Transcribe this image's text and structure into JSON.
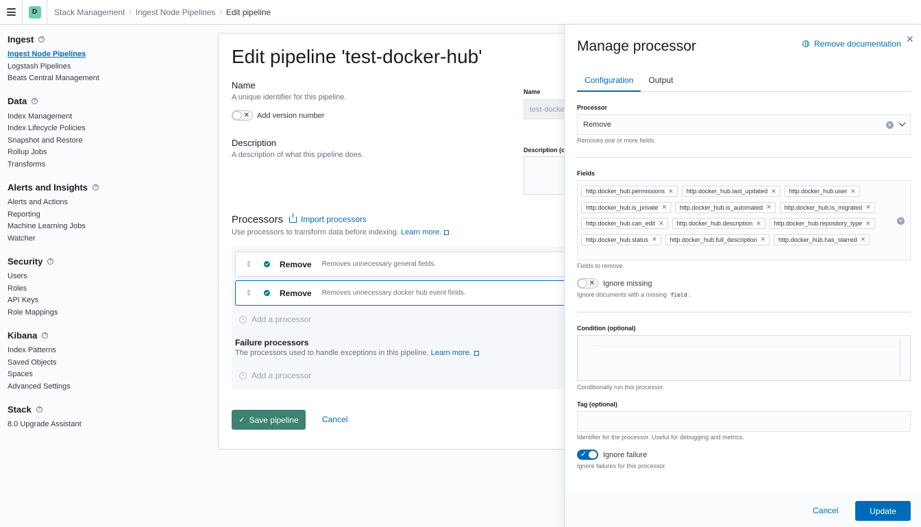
{
  "header": {
    "space_initial": "D",
    "breadcrumbs": [
      "Stack Management",
      "Ingest Node Pipelines",
      "Edit pipeline"
    ]
  },
  "sidebar": {
    "groups": [
      {
        "title": "Ingest",
        "items": [
          "Ingest Node Pipelines",
          "Logstash Pipelines",
          "Beats Central Management"
        ]
      },
      {
        "title": "Data",
        "items": [
          "Index Management",
          "Index Lifecycle Policies",
          "Snapshot and Restore",
          "Rollup Jobs",
          "Transforms"
        ]
      },
      {
        "title": "Alerts and Insights",
        "items": [
          "Alerts and Actions",
          "Reporting",
          "Machine Learning Jobs",
          "Watcher"
        ]
      },
      {
        "title": "Security",
        "items": [
          "Users",
          "Roles",
          "API Keys",
          "Role Mappings"
        ]
      },
      {
        "title": "Kibana",
        "items": [
          "Index Patterns",
          "Saved Objects",
          "Spaces",
          "Advanced Settings"
        ]
      },
      {
        "title": "Stack",
        "items": [
          "8.0 Upgrade Assistant"
        ]
      }
    ],
    "active_item": "Ingest Node Pipelines"
  },
  "main": {
    "title": "Edit pipeline 'test-docker-hub'",
    "name_title": "Name",
    "name_desc": "A unique identifier for this pipeline.",
    "version_toggle_label": "Add version number",
    "name_field_label": "Name",
    "name_field_value": "test-docke",
    "description_title": "Description",
    "description_desc": "A description of what this pipeline does.",
    "description_field_label": "Description (o",
    "processors_title": "Processors",
    "import_label": "Import processors",
    "processors_desc": "Use processors to transform data before indexing.",
    "learn_more": "Learn more.",
    "processors": [
      {
        "name": "Remove",
        "description": "Removes unnecessary general fields."
      },
      {
        "name": "Remove",
        "description": "Removes unnecessary docker hub event fields."
      }
    ],
    "add_processor": "Add a processor",
    "failure_title": "Failure processors",
    "failure_desc": "The processors used to handle exceptions in this pipeline.",
    "save_label": "Save pipeline",
    "cancel_label": "Cancel"
  },
  "flyout": {
    "title": "Manage processor",
    "remove_doc_label": "Remove documentation",
    "tabs": [
      "Configuration",
      "Output"
    ],
    "processor_label": "Processor",
    "processor_value": "Remove",
    "processor_help": "Removes one or more fields.",
    "fields_label": "Fields",
    "fields": [
      "http.docker_hub.permissions",
      "http.docker_hub.last_updated",
      "http.docker_hub.user",
      "http.docker_hub.is_private",
      "http.docker_hub.is_automated",
      "http.docker_hub.is_migrated",
      "http.docker_hub.can_edit",
      "http.docker_hub.description",
      "http.docker_hub.repository_type",
      "http.docker_hub.status",
      "http.docker_hub.full_description",
      "http.docker_hub.has_starred"
    ],
    "fields_help": "Fields to remove.",
    "ignore_missing_label": "Ignore missing",
    "ignore_missing_help_prefix": "Ignore documents with a missing",
    "ignore_missing_help_code": "field",
    "ignore_missing_help_suffix": ".",
    "condition_label": "Condition (optional)",
    "condition_help": "Conditionally run this processor.",
    "tag_label": "Tag (optional)",
    "tag_help": "Identifier for the processor. Useful for debugging and metrics.",
    "ignore_failure_label": "Ignore failure",
    "ignore_failure_help": "Ignore failures for this processor.",
    "cancel_label": "Cancel",
    "update_label": "Update"
  },
  "colors": {
    "accent": "#006bb8",
    "success": "#3b8271",
    "status_ok": "#017d73"
  }
}
